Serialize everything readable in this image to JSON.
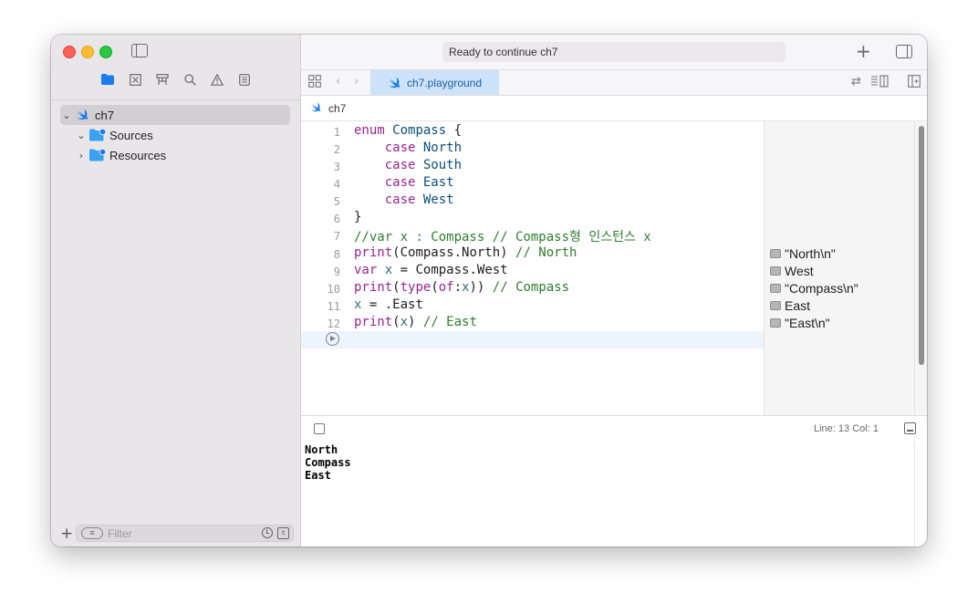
{
  "window": {
    "activity_status": "Ready to continue ch7"
  },
  "sidebar": {
    "tree": [
      {
        "label": "ch7",
        "expanded": true,
        "selected": true,
        "icon": "swift-icon"
      },
      {
        "label": "Sources",
        "expanded": true,
        "icon": "folder-icon"
      },
      {
        "label": "Resources",
        "expanded": false,
        "icon": "folder-icon"
      }
    ],
    "filter_placeholder": "Filter"
  },
  "tabs": [
    {
      "label": "ch7.playground",
      "active": true
    }
  ],
  "jumpbar": {
    "path": "ch7"
  },
  "editor": {
    "line_numbers": [
      "1",
      "2",
      "3",
      "4",
      "5",
      "6",
      "7",
      "8",
      "9",
      "10",
      "11",
      "12"
    ],
    "lines": [
      "enum Compass {",
      "    case North",
      "    case South",
      "    case East",
      "    case West",
      "}",
      "//var x : Compass // Compass형 인스턴스 x",
      "print(Compass.North) // North",
      "var x = Compass.West",
      "print(type(of:x)) // Compass",
      "x = .East",
      "print(x) // East"
    ],
    "results": [
      "\"North\\n\"",
      "West",
      "\"Compass\\n\"",
      "East",
      "\"East\\n\""
    ]
  },
  "status": {
    "line_col": "Line: 13  Col: 1"
  },
  "console": {
    "output": [
      "North",
      "Compass",
      "East"
    ]
  },
  "colors": {
    "keyword": "#9b2393",
    "type": "#0b4f79",
    "comment": "#2e7d2e",
    "identifier": "#326d74",
    "active_tab": "#cde3f9",
    "selection": "#d2cfd3"
  }
}
